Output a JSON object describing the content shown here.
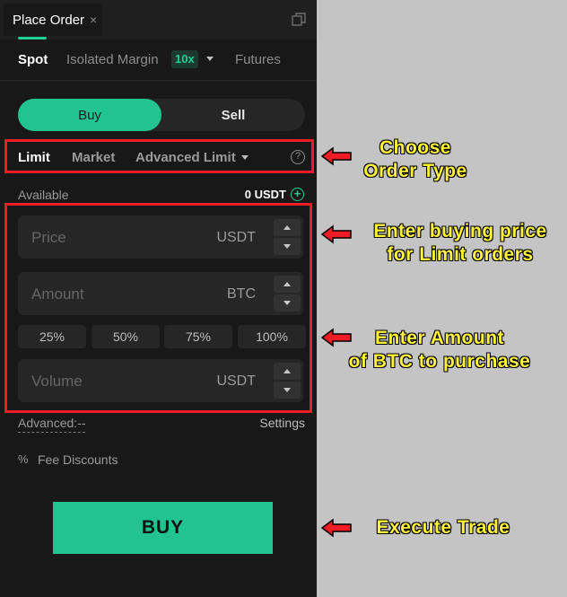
{
  "window": {
    "tab_title": "Place Order",
    "close_glyph": "×"
  },
  "trade_modes": {
    "spot": "Spot",
    "isolated_margin": "Isolated Margin",
    "leverage": "10x",
    "futures": "Futures"
  },
  "side": {
    "buy": "Buy",
    "sell": "Sell"
  },
  "order_types": {
    "limit": "Limit",
    "market": "Market",
    "advanced_limit": "Advanced Limit",
    "help_glyph": "?"
  },
  "balance": {
    "label": "Available",
    "value": "0 USDT",
    "plus_glyph": "+"
  },
  "fields": {
    "price": {
      "placeholder": "Price",
      "unit": "USDT"
    },
    "amount": {
      "placeholder": "Amount",
      "unit": "BTC"
    },
    "volume": {
      "placeholder": "Volume",
      "unit": "USDT"
    }
  },
  "percent_options": [
    "25%",
    "50%",
    "75%",
    "100%"
  ],
  "advanced": {
    "label": "Advanced:--",
    "settings": "Settings"
  },
  "fee": {
    "icon_glyph": "%",
    "label": "Fee Discounts"
  },
  "action": {
    "buy_label": "BUY"
  },
  "annotations": {
    "order_type": [
      "Choose",
      "Order Type"
    ],
    "price": [
      "Enter buying price",
      "for Limit orders"
    ],
    "amount": [
      "Enter Amount",
      "of BTC to purchase"
    ],
    "execute": [
      "Execute Trade"
    ]
  },
  "colors": {
    "accent": "#21c38e",
    "highlight_box": "#ee1c24",
    "annotation_text": "#fff23a",
    "panel_bg": "#181818"
  },
  "icons": {
    "popout": "popout-icon",
    "help": "help-icon",
    "add_funds": "plus-circle-icon",
    "fee": "percent-icon",
    "arrow": "red-arrow-icon"
  }
}
